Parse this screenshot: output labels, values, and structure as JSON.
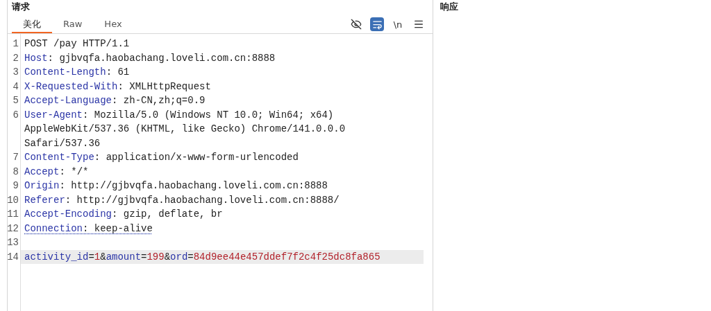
{
  "request": {
    "title": "请求",
    "tabs": [
      {
        "label": "美化",
        "selected": true
      },
      {
        "label": "Raw",
        "selected": false
      },
      {
        "label": "Hex",
        "selected": false
      }
    ],
    "toolbar": [
      {
        "kind": "hide",
        "on": false
      },
      {
        "kind": "wrap",
        "on": true
      },
      {
        "kind": "newline",
        "label": "\\n",
        "on": false
      },
      {
        "kind": "menu",
        "on": false
      }
    ],
    "lines": [
      {
        "number": "1",
        "kind": "request_line",
        "text": "POST /pay HTTP/1.1",
        "highlighted": false,
        "flagged": false
      },
      {
        "number": "2",
        "kind": "header",
        "name": "Host",
        "separator": ": ",
        "value": "gjbvqfa.haobachang.loveli.com.cn:8888",
        "highlighted": false,
        "flagged": false
      },
      {
        "number": "3",
        "kind": "header",
        "name": "Content-Length",
        "separator": ": ",
        "value": "61",
        "highlighted": false,
        "flagged": false
      },
      {
        "number": "4",
        "kind": "header",
        "name": "X-Requested-With",
        "separator": ": ",
        "value": "XMLHttpRequest",
        "highlighted": false,
        "flagged": false
      },
      {
        "number": "5",
        "kind": "header",
        "name": "Accept-Language",
        "separator": ": ",
        "value": "zh-CN,zh;q=0.9",
        "highlighted": false,
        "flagged": false
      },
      {
        "number": "6",
        "kind": "header",
        "name": "User-Agent",
        "separator": ": ",
        "value": "Mozilla/5.0 (Windows NT 10.0; Win64; x64) AppleWebKit/537.36 (KHTML, like Gecko) Chrome/141.0.0.0 Safari/537.36",
        "highlighted": false,
        "flagged": false
      },
      {
        "number": "7",
        "kind": "header",
        "name": "Content-Type",
        "separator": ": ",
        "value": "application/x-www-form-urlencoded",
        "highlighted": false,
        "flagged": false
      },
      {
        "number": "8",
        "kind": "header",
        "name": "Accept",
        "separator": ": ",
        "value": "*/*",
        "highlighted": false,
        "flagged": false
      },
      {
        "number": "9",
        "kind": "header",
        "name": "Origin",
        "separator": ": ",
        "value": "http://gjbvqfa.haobachang.loveli.com.cn:8888",
        "highlighted": false,
        "flagged": false
      },
      {
        "number": "10",
        "kind": "header",
        "name": "Referer",
        "separator": ": ",
        "value": "http://gjbvqfa.haobachang.loveli.com.cn:8888/",
        "highlighted": false,
        "flagged": false
      },
      {
        "number": "11",
        "kind": "header",
        "name": "Accept-Encoding",
        "separator": ": ",
        "value": "gzip, deflate, br",
        "highlighted": false,
        "flagged": false
      },
      {
        "number": "12",
        "kind": "header",
        "name": "Connection",
        "separator": ": ",
        "value": "keep-alive",
        "highlighted": false,
        "flagged": true
      },
      {
        "number": "13",
        "kind": "blank"
      },
      {
        "number": "14",
        "kind": "body",
        "segments": [
          {
            "kind": "key",
            "text": "activity_id"
          },
          {
            "kind": "plain",
            "text": "="
          },
          {
            "kind": "value",
            "text": "1"
          },
          {
            "kind": "plain",
            "text": "&"
          },
          {
            "kind": "key",
            "text": "amount"
          },
          {
            "kind": "plain",
            "text": "="
          },
          {
            "kind": "value",
            "text": "199"
          },
          {
            "kind": "plain",
            "text": "&"
          },
          {
            "kind": "key",
            "text": "ord"
          },
          {
            "kind": "plain",
            "text": "="
          },
          {
            "kind": "value",
            "text": "84d9ee44e457ddef7f2c4f25dc8fa865"
          }
        ],
        "highlighted": true,
        "flagged": false
      }
    ]
  },
  "response": {
    "title": "响应"
  }
}
